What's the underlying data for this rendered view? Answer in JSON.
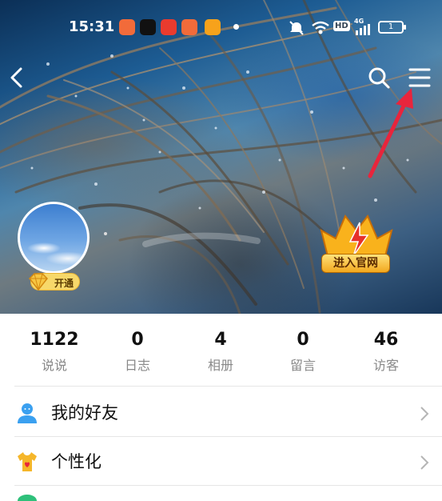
{
  "status_bar": {
    "time": "15:31",
    "network": "4G",
    "hd_label": "HD",
    "battery": "1"
  },
  "nav": {
    "back_icon": "chevron-left-icon",
    "search_icon": "search-icon",
    "menu_icon": "hamburger-menu-icon"
  },
  "profile": {
    "vip_badge_label": "开通",
    "official_site_label": "进入官网"
  },
  "stats": [
    {
      "value": "1122",
      "label": "说说"
    },
    {
      "value": "0",
      "label": "日志"
    },
    {
      "value": "4",
      "label": "相册"
    },
    {
      "value": "0",
      "label": "留言"
    },
    {
      "value": "46",
      "label": "访客"
    }
  ],
  "menu": [
    {
      "label": "我的好友",
      "icon": "friend-person-icon"
    },
    {
      "label": "个性化",
      "icon": "tshirt-heart-icon"
    }
  ],
  "colors": {
    "annotation_arrow": "#e8253c",
    "vip_gold": "#f7d86a",
    "friend_icon": "#3aa0f0",
    "personalize_icon": "#f5b62a"
  }
}
